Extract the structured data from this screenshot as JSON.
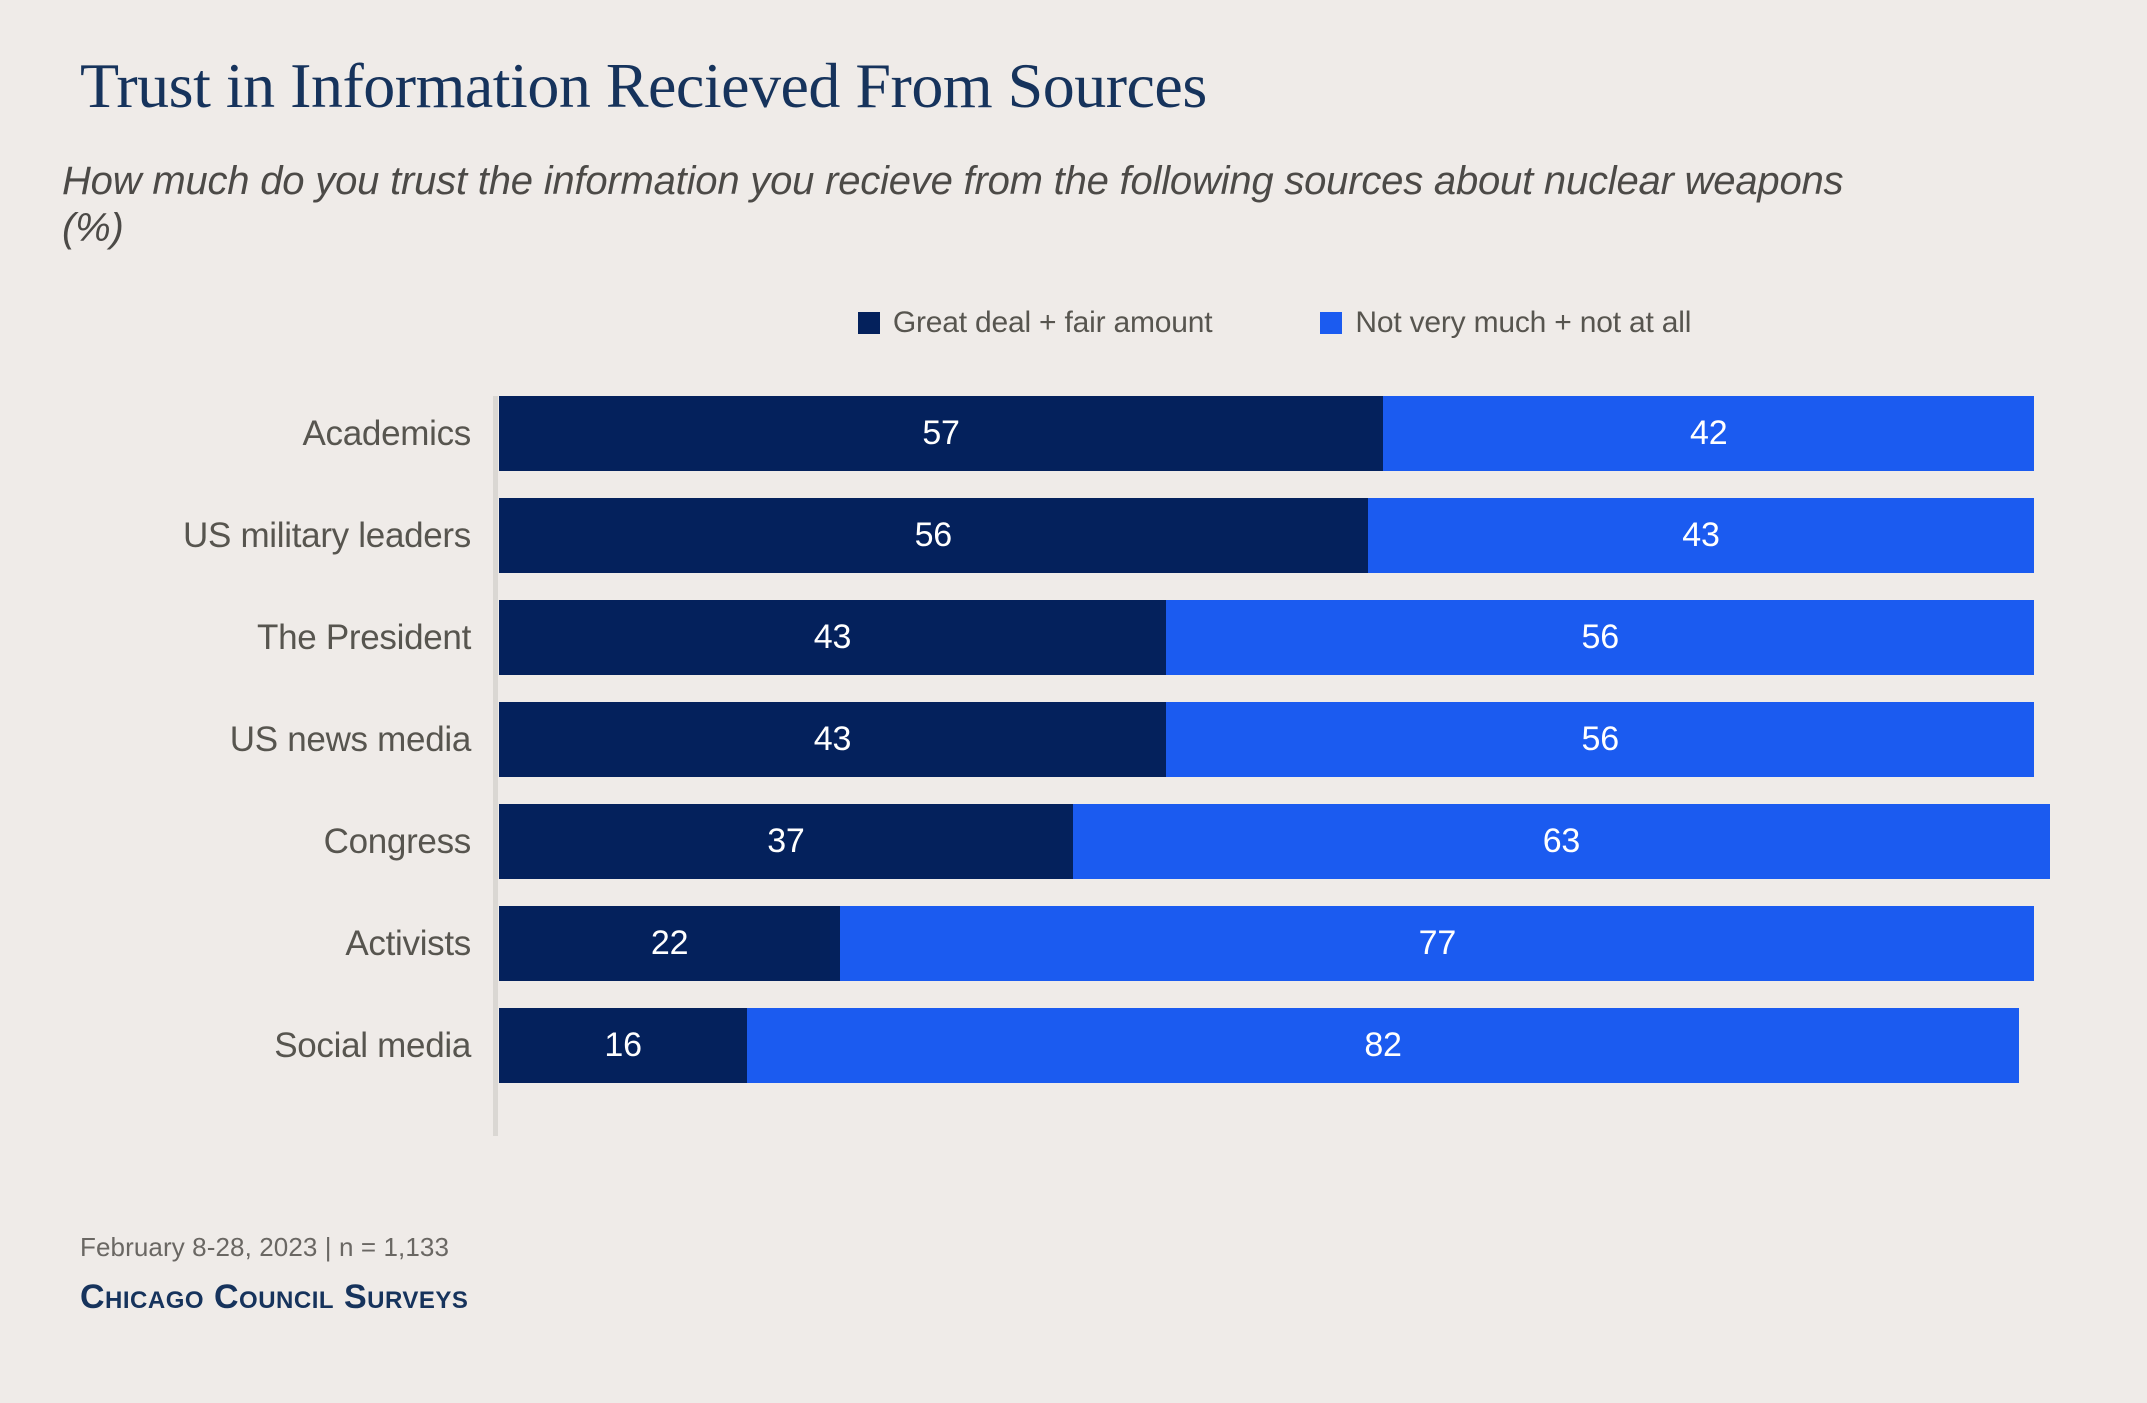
{
  "header": {
    "title": "Trust in Information Recieved From Sources",
    "subtitle": "How much do you trust the information you recieve from the following sources about nuclear weapons (%)"
  },
  "legend": {
    "items": [
      {
        "label": "Great deal + fair amount",
        "color": "#04215c",
        "key": "trust"
      },
      {
        "label": "Not very much + not at all",
        "color": "#1b5bf0",
        "key": "distrust"
      }
    ]
  },
  "footer": {
    "note": "February 8-28, 2023 | n = 1,133",
    "brand": "Chicago Council Surveys"
  },
  "colors": {
    "background": "#efebe8",
    "navy": "#04215c",
    "blue": "#1b5bf0",
    "title": "#16335c",
    "text_gray": "#57554f",
    "axis": "#dad7d3"
  },
  "chart_data": {
    "type": "bar",
    "orientation": "horizontal",
    "stacked": true,
    "title": "Trust in Information Recieved From Sources",
    "subtitle": "How much do you trust the information you recieve from the following sources about nuclear weapons (%)",
    "xlabel": "",
    "ylabel": "",
    "xlim": [
      0,
      100
    ],
    "grid": false,
    "legend_position": "top-center",
    "categories": [
      "Academics",
      "US military leaders",
      "The President",
      "US news media",
      "Congress",
      "Activists",
      "Social media"
    ],
    "series": [
      {
        "name": "Great deal + fair amount",
        "color": "#04215c",
        "values": [
          57,
          56,
          43,
          43,
          37,
          22,
          16
        ]
      },
      {
        "name": "Not very much + not at all",
        "color": "#1b5bf0",
        "values": [
          42,
          43,
          56,
          56,
          63,
          77,
          82
        ]
      }
    ],
    "rows": [
      {
        "category": "Academics",
        "trust": 57,
        "distrust": 42
      },
      {
        "category": "US military leaders",
        "trust": 56,
        "distrust": 43
      },
      {
        "category": "The President",
        "trust": 43,
        "distrust": 56
      },
      {
        "category": "US news media",
        "trust": 43,
        "distrust": 56
      },
      {
        "category": "Congress",
        "trust": 37,
        "distrust": 63
      },
      {
        "category": "Activists",
        "trust": 22,
        "distrust": 77
      },
      {
        "category": "Social media",
        "trust": 16,
        "distrust": 82
      }
    ]
  }
}
